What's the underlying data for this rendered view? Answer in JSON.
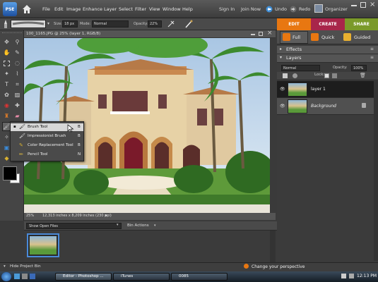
{
  "menubar": {
    "logo": "PSE",
    "items": [
      "File",
      "Edit",
      "Image",
      "Enhance",
      "Layer",
      "Select",
      "Filter",
      "View",
      "Window",
      "Help"
    ],
    "sign_in": "Sign In",
    "join_now": "Join Now",
    "undo": "Undo",
    "redo": "Redo",
    "organizer": "Organizer"
  },
  "options_bar": {
    "size_label": "Size:",
    "size_value": "18 px",
    "mode_label": "Mode:",
    "mode_value": "Normal",
    "opacity_label": "Opacity:",
    "opacity_value": "22%"
  },
  "mode_tabs": {
    "edit": "EDIT",
    "create": "CREATE",
    "share": "SHARE"
  },
  "document": {
    "title": "100_1165.JPG @ 25% (layer 1, RGB/8)",
    "zoom": "25%",
    "dimensions": "12,313 inches x 8,209 inches (230 ppi)"
  },
  "flyout": {
    "items": [
      {
        "label": "Brush Tool",
        "key": "B"
      },
      {
        "label": "Impressionist Brush",
        "key": "B"
      },
      {
        "label": "Color Replacement Tool",
        "key": "B"
      },
      {
        "label": "Pencil Tool",
        "key": "N"
      }
    ]
  },
  "panel_tabs": {
    "full": "Full",
    "quick": "Quick",
    "guided": "Guided"
  },
  "effects": {
    "title": "Effects"
  },
  "layers": {
    "title": "Layers",
    "blend_mode": "Normal",
    "opacity_label": "Opacity:",
    "opacity_value": "100%",
    "lock_label": "Lock:",
    "items": [
      {
        "name": "layer 1"
      },
      {
        "name": "Background"
      }
    ]
  },
  "project_bin": {
    "dropdown": "Show Open Files",
    "actions": "Bin Actions",
    "hide_label": "Hide Project Bin",
    "perspective": "Change your perspective"
  },
  "taskbar": {
    "buttons": [
      "Editor - Photoshop ...",
      "iTunes",
      "0085"
    ],
    "time": "12:13 PM"
  },
  "colors": {
    "edit": "#e87711",
    "create": "#a8264a",
    "share": "#7a9a2a"
  }
}
